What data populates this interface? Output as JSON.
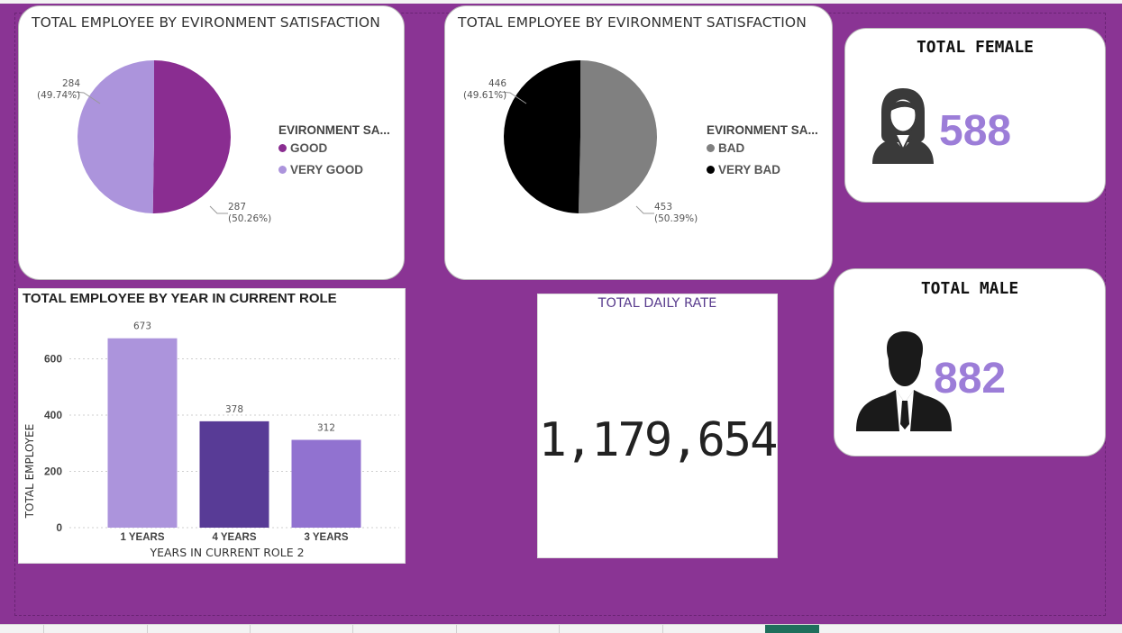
{
  "pie_good": {
    "title": "TOTAL EMPLOYEE BY EVIRONMENT SATISFACTION",
    "legend_title": "EVIRONMENT SA...",
    "slices": [
      {
        "label": "GOOD",
        "value": 287,
        "pct": "(50.26%)",
        "color": "#8a2d91"
      },
      {
        "label": "VERY GOOD",
        "value": 284,
        "pct": "(49.74%)",
        "color": "#ac94dc"
      }
    ]
  },
  "pie_bad": {
    "title": "TOTAL EMPLOYEE BY EVIRONMENT SATISFACTION",
    "legend_title": "EVIRONMENT SA...",
    "slices": [
      {
        "label": "BAD",
        "value": 453,
        "pct": "(50.39%)",
        "color": "#808080"
      },
      {
        "label": "VERY BAD",
        "value": 446,
        "pct": "(49.61%)",
        "color": "#000000"
      }
    ]
  },
  "kpi_female": {
    "title": "TOTAL FEMALE",
    "value": "588",
    "icon": "female-person-icon"
  },
  "kpi_male": {
    "title": "TOTAL MALE",
    "value": "882",
    "icon": "male-person-icon"
  },
  "daily_rate": {
    "title": "TOTAL DAILY RATE",
    "value": "1,179,654"
  },
  "bar_chart": {
    "title": "TOTAL EMPLOYEE BY YEAR IN CURRENT ROLE",
    "xlabel": "YEARS IN CURRENT ROLE 2",
    "ylabel": "TOTAL EMPLOYEE"
  },
  "chart_data": [
    {
      "type": "pie",
      "title": "TOTAL EMPLOYEE BY EVIRONMENT SATISFACTION",
      "legend_title": "EVIRONMENT SA...",
      "categories": [
        "GOOD",
        "VERY GOOD"
      ],
      "values": [
        287,
        284
      ],
      "percentages": [
        "(50.26%)",
        "(49.74%)"
      ],
      "legend": "right"
    },
    {
      "type": "pie",
      "title": "TOTAL EMPLOYEE BY EVIRONMENT SATISFACTION",
      "legend_title": "EVIRONMENT SA...",
      "categories": [
        "BAD",
        "VERY BAD"
      ],
      "values": [
        453,
        446
      ],
      "percentages": [
        "(50.39%)",
        "(49.61%)"
      ],
      "legend": "right"
    },
    {
      "type": "bar",
      "title": "TOTAL EMPLOYEE BY YEAR IN CURRENT ROLE",
      "categories": [
        "1 YEARS",
        "4 YEARS",
        "3 YEARS"
      ],
      "values": [
        673,
        378,
        312
      ],
      "colors": [
        "#ac94dc",
        "#583b96",
        "#9172d0"
      ],
      "xlabel": "YEARS IN CURRENT ROLE 2",
      "ylabel": "TOTAL EMPLOYEE",
      "yticks": [
        0,
        200,
        400,
        600
      ],
      "ylim": [
        0,
        720
      ],
      "grid": true
    }
  ]
}
